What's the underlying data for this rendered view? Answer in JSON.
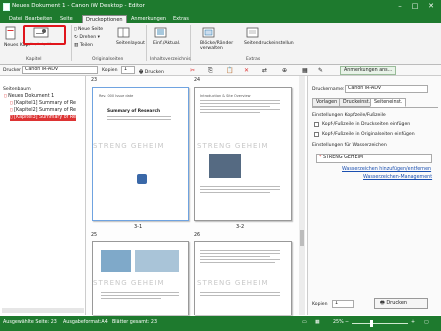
{
  "window": {
    "title": "Neues Dokument 1 - Canon iW Desktop - Editor"
  },
  "menu_tabs": [
    "Datei",
    "Bearbeiten",
    "Seite",
    "Druckoptionen",
    "Anmerkungen",
    "Extras"
  ],
  "ribbon": {
    "neues_kap": "Neues Kap.",
    "kapitelgroesse": "Kapitelgröße",
    "neue_seite": "Neue Seite",
    "drehen": "Drehen",
    "teilen": "Teilen",
    "seitenlayout": "Seitenlayout",
    "inhaltsverz": "Einf./Aktual.",
    "bloecke": "Blöcke/Ränder verwalten",
    "seitendruck": "Seitendruckeinstellun",
    "group_kapitel": "Kapitel",
    "group_originalseiten": "Originalseiten",
    "group_inhaltsverzeichnis": "Inhaltsverzeichnis",
    "group_extras": "Extras"
  },
  "address": {
    "drucker_label": "Drucker",
    "drucker_value": "Canon iR-ADV",
    "kopien_label": "Kopien",
    "kopien_value": "1",
    "drucken": "Drucken",
    "anmerkungen_btn": "Anmerkungen ans..."
  },
  "leftpane": {
    "title": "Seitenbaum",
    "items": [
      "Neues Dokument 1",
      "[Kapitel1] Summary of Re",
      "[Kapitel2] Summary of Re",
      "[Kapitel3] Summary of Re"
    ]
  },
  "viewer": {
    "page_numbers": [
      "23",
      "24",
      "25",
      "26"
    ],
    "labels": [
      "3-1",
      "3-2"
    ],
    "watermark": "STRENG GEHEIM",
    "page1_title": "Summary of Research",
    "page1_header": "Rev. 000 Issue date",
    "page2_header": "Introduction & Site Overview"
  },
  "rightpane": {
    "druckername_label": "Druckername:",
    "druckername_value": "Canon iR-ADV",
    "tabs": [
      "Vorlagen",
      "Druckeinst.",
      "Seiteneinst."
    ],
    "kopf_header": "Einstellungen Kopfzeile/Fußzeile",
    "chk1": "Kopf-/Fußzeile in Druckseiten einfügen",
    "chk2": "Kopf-/Fußzeile in Originalseiten einfügen",
    "wm_header": "Einstellungen für Wasserzeichen",
    "wm_value": "STRENG GEHEIM",
    "link1": "Wasserzeichen hinzufügen/entfernen",
    "link2": "Wasserzeichen-Management",
    "kopien_label": "Kopien",
    "kopien_value": "1",
    "drucken": "Drucken"
  },
  "status": {
    "ausgewaehlte": "Ausgewählte Seite: 23",
    "format": "Ausgabeformat:A4",
    "blaetter": "Blätter gesamt: 23",
    "zoom": "25%"
  },
  "colors": {
    "accent": "#1e7a2e",
    "highlight": "#e0151b",
    "link": "#1a4fb0"
  }
}
